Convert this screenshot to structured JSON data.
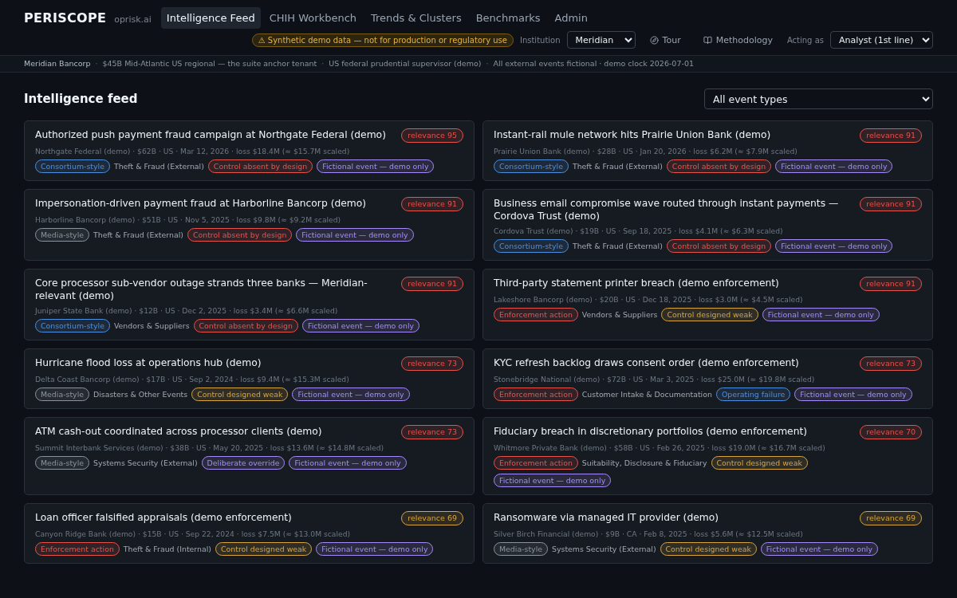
{
  "brand": {
    "name": "PERISCOPE",
    "domain": "oprisk.ai"
  },
  "nav": [
    {
      "label": "Intelligence Feed",
      "selected": true
    },
    {
      "label": "CHIH Workbench",
      "selected": false
    },
    {
      "label": "Trends & Clusters",
      "selected": false
    },
    {
      "label": "Benchmarks",
      "selected": false
    },
    {
      "label": "Admin",
      "selected": false
    }
  ],
  "toolbar": {
    "warning": "⚠ Synthetic demo data — not for production or regulatory use",
    "institution_label": "Institution",
    "institution": "Meridian",
    "tour": "Tour",
    "methodology": "Methodology",
    "acting_label": "Acting as",
    "acting": "Analyst (1st line)"
  },
  "context_separator": "·",
  "context_bar": [
    "Meridian Bancorp",
    "$45B Mid-Atlantic US regional — the suite anchor tenant",
    "US federal prudential supervisor (demo)",
    "All external events fictional · demo clock 2026-07-01"
  ],
  "feed": {
    "title": "Intelligence feed",
    "filter": "All event types",
    "cards": [
      {
        "title": "Authorized push payment fraud campaign at Northgate Federal (demo)",
        "relevance": {
          "text": "relevance 95",
          "color": "#e5534b"
        },
        "meta": "Northgate Federal (demo) · $62B · US · Mar 12, 2026 · loss $18.4M (≈ $15.7M scaled)",
        "tags": [
          {
            "kind": "pill",
            "text": "Consortium-style",
            "color": "#4a8fe0"
          },
          {
            "kind": "plain",
            "text": "Theft & Fraud (External)"
          },
          {
            "kind": "pill",
            "text": "Control absent by design",
            "color": "#e5534b"
          },
          {
            "kind": "pill",
            "text": "Fictional event — demo only",
            "color": "#a78bfa"
          }
        ]
      },
      {
        "title": "Instant-rail mule network hits Prairie Union Bank (demo)",
        "relevance": {
          "text": "relevance 91",
          "color": "#e5534b"
        },
        "meta": "Prairie Union Bank (demo) · $28B · US · Jan 20, 2026 · loss $6.2M (≈ $7.9M scaled)",
        "tags": [
          {
            "kind": "pill",
            "text": "Consortium-style",
            "color": "#4a8fe0"
          },
          {
            "kind": "plain",
            "text": "Theft & Fraud (External)"
          },
          {
            "kind": "pill",
            "text": "Control absent by design",
            "color": "#e5534b"
          },
          {
            "kind": "pill",
            "text": "Fictional event — demo only",
            "color": "#a78bfa"
          }
        ]
      },
      {
        "title": "Impersonation-driven payment fraud at Harborline Bancorp (demo)",
        "relevance": {
          "text": "relevance 91",
          "color": "#e5534b"
        },
        "meta": "Harborline Bancorp (demo) · $51B · US · Nov 5, 2025 · loss $9.8M (≈ $9.2M scaled)",
        "tags": [
          {
            "kind": "pill",
            "text": "Media-style",
            "color": "#8b949e"
          },
          {
            "kind": "plain",
            "text": "Theft & Fraud (External)"
          },
          {
            "kind": "pill",
            "text": "Control absent by design",
            "color": "#e5534b"
          },
          {
            "kind": "pill",
            "text": "Fictional event — demo only",
            "color": "#a78bfa"
          }
        ]
      },
      {
        "title": "Business email compromise wave routed through instant payments — Cordova Trust (demo)",
        "relevance": {
          "text": "relevance 91",
          "color": "#e5534b"
        },
        "meta": "Cordova Trust (demo) · $19B · US · Sep 18, 2025 · loss $4.1M (≈ $6.3M scaled)",
        "tags": [
          {
            "kind": "pill",
            "text": "Consortium-style",
            "color": "#4a8fe0"
          },
          {
            "kind": "plain",
            "text": "Theft & Fraud (External)"
          },
          {
            "kind": "pill",
            "text": "Control absent by design",
            "color": "#e5534b"
          },
          {
            "kind": "pill",
            "text": "Fictional event — demo only",
            "color": "#a78bfa"
          }
        ]
      },
      {
        "title": "Core processor sub-vendor outage strands three banks — Meridian-relevant (demo)",
        "relevance": {
          "text": "relevance 91",
          "color": "#e5534b"
        },
        "meta": "Juniper State Bank (demo) · $12B · US · Dec 2, 2025 · loss $3.4M (≈ $6.6M scaled)",
        "tags": [
          {
            "kind": "pill",
            "text": "Consortium-style",
            "color": "#4a8fe0"
          },
          {
            "kind": "plain",
            "text": "Vendors & Suppliers"
          },
          {
            "kind": "pill",
            "text": "Control absent by design",
            "color": "#e5534b"
          },
          {
            "kind": "pill",
            "text": "Fictional event — demo only",
            "color": "#a78bfa"
          }
        ]
      },
      {
        "title": "Third-party statement printer breach (demo enforcement)",
        "relevance": {
          "text": "relevance 91",
          "color": "#e5534b"
        },
        "meta": "Lakeshore Bancorp (demo) · $20B · US · Dec 18, 2025 · loss $3.0M (≈ $4.5M scaled)",
        "tags": [
          {
            "kind": "pill",
            "text": "Enforcement action",
            "color": "#e5534b"
          },
          {
            "kind": "plain",
            "text": "Vendors & Suppliers"
          },
          {
            "kind": "pill",
            "text": "Control designed weak",
            "color": "#d9a53c"
          },
          {
            "kind": "pill",
            "text": "Fictional event — demo only",
            "color": "#a78bfa"
          }
        ]
      },
      {
        "title": "Hurricane flood loss at operations hub (demo)",
        "relevance": {
          "text": "relevance 73",
          "color": "#e5534b"
        },
        "meta": "Delta Coast Bancorp (demo) · $17B · US · Sep 2, 2024 · loss $9.4M (≈ $15.3M scaled)",
        "tags": [
          {
            "kind": "pill",
            "text": "Media-style",
            "color": "#8b949e"
          },
          {
            "kind": "plain",
            "text": "Disasters & Other Events"
          },
          {
            "kind": "pill",
            "text": "Control designed weak",
            "color": "#d9a53c"
          },
          {
            "kind": "pill",
            "text": "Fictional event — demo only",
            "color": "#a78bfa"
          }
        ]
      },
      {
        "title": "KYC refresh backlog draws consent order (demo enforcement)",
        "relevance": {
          "text": "relevance 73",
          "color": "#e5534b"
        },
        "meta": "Stonebridge National (demo) · $72B · US · Mar 3, 2025 · loss $25.0M (≈ $19.8M scaled)",
        "tags": [
          {
            "kind": "pill",
            "text": "Enforcement action",
            "color": "#e5534b"
          },
          {
            "kind": "plain",
            "text": "Customer Intake & Documentation"
          },
          {
            "kind": "pill",
            "text": "Operating failure",
            "color": "#4a8fe0"
          },
          {
            "kind": "pill",
            "text": "Fictional event — demo only",
            "color": "#a78bfa"
          }
        ]
      },
      {
        "title": "ATM cash-out coordinated across processor clients (demo)",
        "relevance": {
          "text": "relevance 73",
          "color": "#e5534b"
        },
        "meta": "Summit Interbank Services (demo) · $38B · US · May 20, 2025 · loss $13.6M (≈ $14.8M scaled)",
        "tags": [
          {
            "kind": "pill",
            "text": "Media-style",
            "color": "#8b949e"
          },
          {
            "kind": "plain",
            "text": "Systems Security (External)"
          },
          {
            "kind": "pill",
            "text": "Deliberate override",
            "color": "#a78bfa"
          },
          {
            "kind": "pill",
            "text": "Fictional event — demo only",
            "color": "#a78bfa"
          }
        ]
      },
      {
        "title": "Fiduciary breach in discretionary portfolios (demo enforcement)",
        "relevance": {
          "text": "relevance 70",
          "color": "#e5534b"
        },
        "meta": "Whitmore Private Bank (demo) · $58B · US · Feb 26, 2025 · loss $19.0M (≈ $16.7M scaled)",
        "tags": [
          {
            "kind": "pill",
            "text": "Enforcement action",
            "color": "#e5534b"
          },
          {
            "kind": "plain",
            "text": "Suitability, Disclosure & Fiduciary"
          },
          {
            "kind": "pill",
            "text": "Control designed weak",
            "color": "#d9a53c"
          },
          {
            "kind": "pill",
            "text": "Fictional event — demo only",
            "color": "#a78bfa"
          }
        ]
      },
      {
        "title": "Loan officer falsified appraisals (demo enforcement)",
        "relevance": {
          "text": "relevance 69",
          "color": "#d9a53c"
        },
        "meta": "Canyon Ridge Bank (demo) · $15B · US · Sep 22, 2024 · loss $7.5M (≈ $13.0M scaled)",
        "tags": [
          {
            "kind": "pill",
            "text": "Enforcement action",
            "color": "#e5534b"
          },
          {
            "kind": "plain",
            "text": "Theft & Fraud (Internal)"
          },
          {
            "kind": "pill",
            "text": "Control designed weak",
            "color": "#d9a53c"
          },
          {
            "kind": "pill",
            "text": "Fictional event — demo only",
            "color": "#a78bfa"
          }
        ]
      },
      {
        "title": "Ransomware via managed IT provider (demo)",
        "relevance": {
          "text": "relevance 69",
          "color": "#d9a53c"
        },
        "meta": "Silver Birch Financial (demo) · $9B · CA · Feb 8, 2025 · loss $5.6M (≈ $12.5M scaled)",
        "tags": [
          {
            "kind": "pill",
            "text": "Media-style",
            "color": "#8b949e"
          },
          {
            "kind": "plain",
            "text": "Systems Security (External)"
          },
          {
            "kind": "pill",
            "text": "Control designed weak",
            "color": "#d9a53c"
          },
          {
            "kind": "pill",
            "text": "Fictional event — demo only",
            "color": "#a78bfa"
          }
        ]
      }
    ]
  }
}
